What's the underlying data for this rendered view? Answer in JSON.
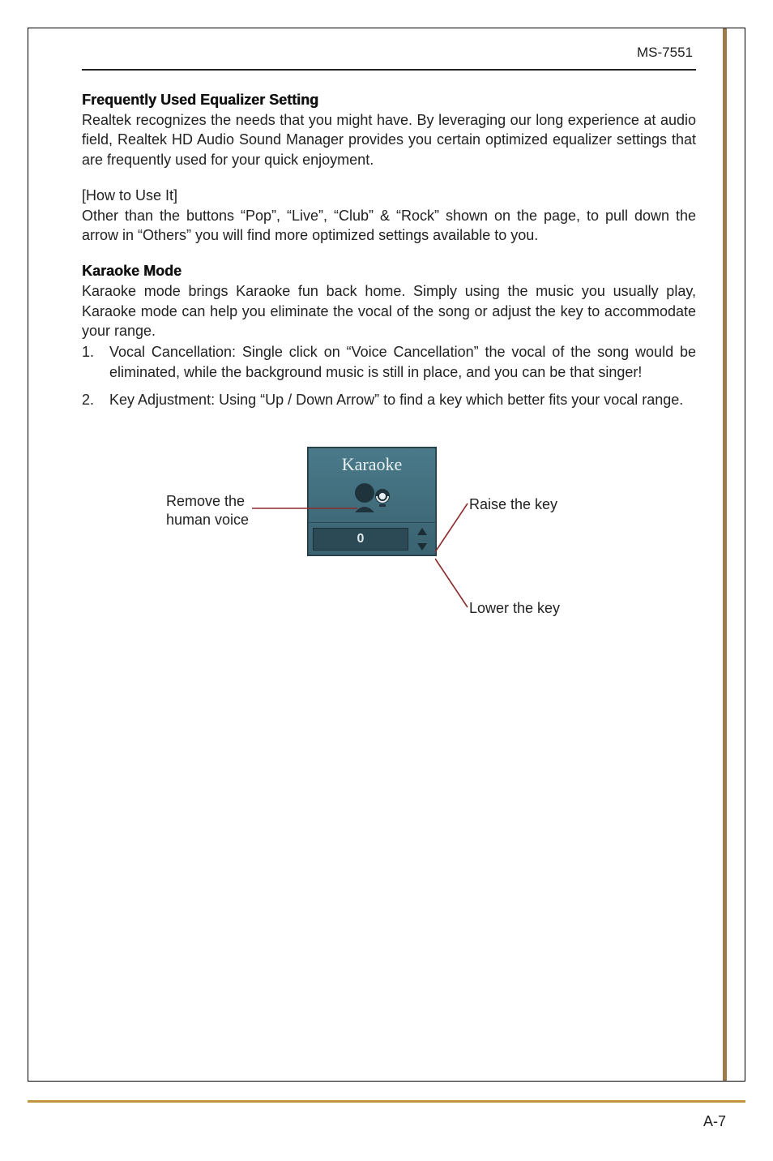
{
  "header": {
    "model": "MS-7551"
  },
  "sections": {
    "eq": {
      "title": "Frequently Used Equalizer Setting",
      "body": "Realtek recognizes the needs that you might have. By leveraging our long experience at audio field, Realtek HD Audio Sound Manager provides you certain optimized equalizer settings that are frequently used for your quick enjoyment.",
      "howto_label": "[How to Use It]",
      "howto_body": "Other than the buttons “Pop”, “Live”, “Club” & “Rock” shown on the page, to pull down the arrow in “Others” you will find more optimized settings available to you."
    },
    "karaoke": {
      "title": "Karaoke Mode",
      "body": "Karaoke mode brings Karaoke fun back home. Simply using the music you usually play, Karaoke mode can help you eliminate the vocal of the song or adjust the key to accommodate your range.",
      "items": [
        "Vocal Cancellation: Single click on “Voice Cancellation” the vocal of the song would be eliminated, while the background music is still in place, and you can be that singer!",
        "Key Adjustment: Using “Up / Down Arrow” to find a key which better fits your vocal range."
      ]
    }
  },
  "diagram": {
    "panel_title": "Karaoke",
    "value": "0",
    "label_left": "Remove  the human voice",
    "label_raise": "Raise the key",
    "label_lower": "Lower the key"
  },
  "footer": {
    "page": "A-7"
  }
}
